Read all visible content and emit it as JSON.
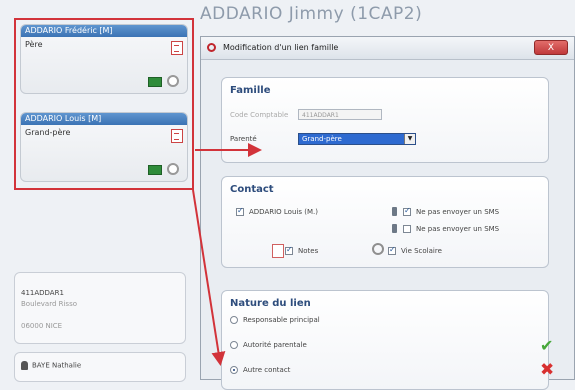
{
  "page_title": "ADDARIO Jimmy (1CAP2)",
  "left_panel": {
    "cards": [
      {
        "name": "ADDARIO Frédéric  [M]",
        "role": "Père"
      },
      {
        "name": "ADDARIO Louis  [M]",
        "role": "Grand-père"
      }
    ]
  },
  "address_card": {
    "code": "411ADDAR1",
    "street": "Boulevard Risso",
    "city": "06000 NICE"
  },
  "contact_card": {
    "name": "BAYE Nathalie"
  },
  "dialog": {
    "title": "Modification d'un lien famille",
    "close_label": "X",
    "famille": {
      "title": "Famille",
      "code_label": "Code Comptable",
      "code_value": "411ADDAR1",
      "parente_label": "Parenté",
      "parente_value": "Grand-père"
    },
    "contact": {
      "title": "Contact",
      "person_label": "ADDARIO Louis (M.)",
      "sms1_label": "Ne pas envoyer un SMS",
      "sms2_label": "Ne pas envoyer un SMS",
      "notes_label": "Notes",
      "vie_label": "Vie Scolaire"
    },
    "nature": {
      "title": "Nature du lien",
      "options": [
        "Responsable principal",
        "Autorité parentale",
        "Autre contact"
      ]
    }
  },
  "colors": {
    "highlight_red": "#d2333a",
    "accent_blue": "#3b73b4",
    "ok_green": "#47a83a",
    "cancel_red": "#d83030"
  },
  "icons": [
    "document-icon",
    "money-icon",
    "link-icon",
    "phone-icon",
    "notes-icon",
    "school-icon",
    "check-icon",
    "cross-icon",
    "person-icon"
  ]
}
